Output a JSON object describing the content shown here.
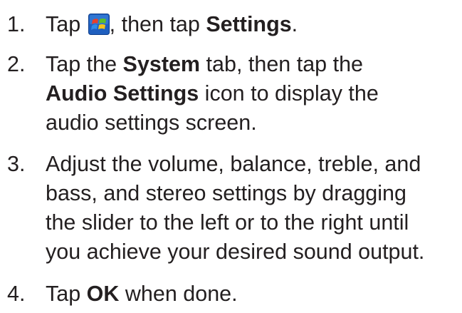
{
  "steps": [
    {
      "number": "1.",
      "segments": {
        "a": "Tap",
        "b": ", then tap",
        "c": "Settings",
        "d": "."
      },
      "icon": "windows-start-icon"
    },
    {
      "number": "2.",
      "segments": {
        "a": "Tap the",
        "b": "System",
        "c": "tab, then tap the",
        "d": "Audio Settings",
        "e": "icon to display the",
        "f": "audio settings screen."
      }
    },
    {
      "number": "3.",
      "lines": [
        "Adjust the volume, balance, treble, and",
        "bass, and stereo settings by dragging",
        "the slider to the left or to the right until",
        "you achieve your desired sound output."
      ]
    },
    {
      "number": "4.",
      "segments": {
        "a": "Tap",
        "b": "OK",
        "c": "when done."
      }
    }
  ]
}
